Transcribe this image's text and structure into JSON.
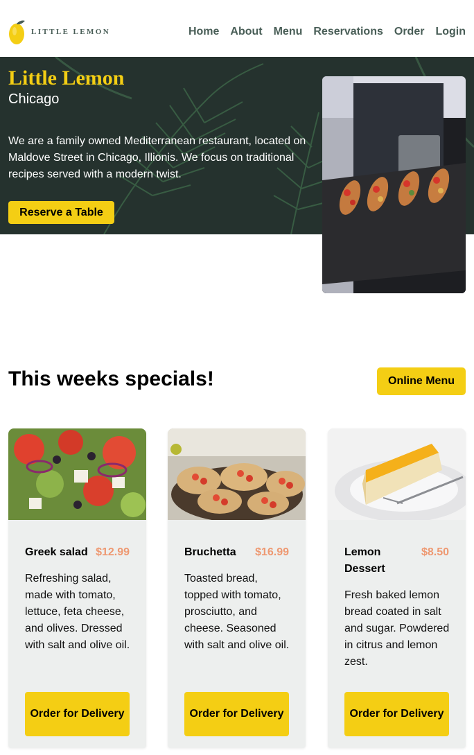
{
  "brand": {
    "logo_text": "LITTLE LEMON"
  },
  "nav": {
    "items": [
      "Home",
      "About",
      "Menu",
      "Reservations",
      "Order",
      "Login"
    ]
  },
  "hero": {
    "title": "Little Lemon",
    "subtitle": "Chicago",
    "description": "We are a family owned Mediterranean restaurant, located on Maldove Street in Chicago, Illionis. We focus on traditional recipes served with a modern twist.",
    "cta": "Reserve a Table"
  },
  "specials": {
    "title": "This weeks specials!",
    "menu_button": "Online Menu",
    "cards": [
      {
        "name": "Greek salad",
        "price": "$12.99",
        "description": "Refreshing salad, made with tomato, lettuce, feta cheese, and olives. Dressed with salt and olive oil.",
        "button": "Order for Delivery"
      },
      {
        "name": "Bruchetta",
        "price": "$16.99",
        "description": "Toasted bread, topped with tomato, prosciutto, and cheese. Seasoned with salt and olive oil.",
        "button": "Order for Delivery"
      },
      {
        "name": "Lemon Dessert",
        "price": "$8.50",
        "description": "Fresh baked lemon bread coated in salt and sugar. Powdered in citrus and lemon zest.",
        "button": "Order for Delivery"
      }
    ]
  },
  "colors": {
    "primary_green": "#495e57",
    "primary_yellow": "#f4ce14",
    "price_salmon": "#ee9972",
    "card_bg": "#edefee"
  }
}
